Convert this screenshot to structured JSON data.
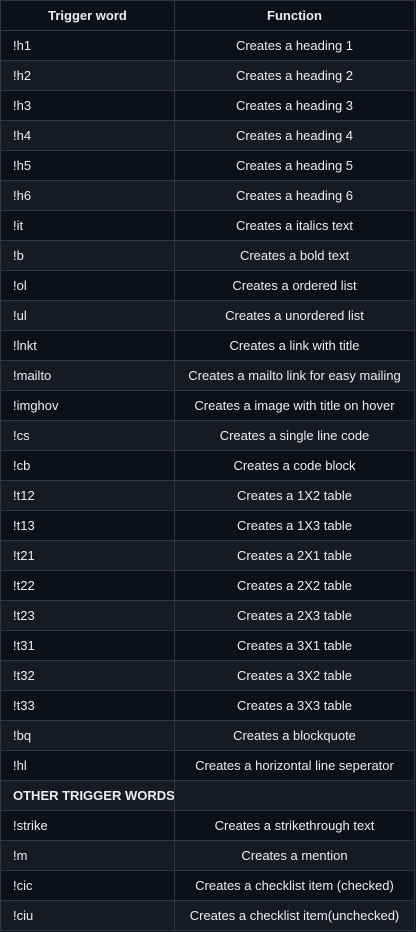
{
  "headers": {
    "trigger": "Trigger word",
    "function": "Function"
  },
  "rows": [
    {
      "trigger": "!h1",
      "function": "Creates a heading 1"
    },
    {
      "trigger": "!h2",
      "function": "Creates a heading 2"
    },
    {
      "trigger": "!h3",
      "function": "Creates a heading 3"
    },
    {
      "trigger": "!h4",
      "function": "Creates a heading 4"
    },
    {
      "trigger": "!h5",
      "function": "Creates a heading 5"
    },
    {
      "trigger": "!h6",
      "function": "Creates a heading 6"
    },
    {
      "trigger": "!it",
      "function": "Creates a italics text"
    },
    {
      "trigger": "!b",
      "function": "Creates a bold text"
    },
    {
      "trigger": "!ol",
      "function": "Creates a ordered list"
    },
    {
      "trigger": "!ul",
      "function": "Creates a unordered list"
    },
    {
      "trigger": "!lnkt",
      "function": "Creates a link with title"
    },
    {
      "trigger": "!mailto",
      "function": "Creates a mailto link for easy mailing"
    },
    {
      "trigger": "!imghov",
      "function": "Creates a image with title on hover"
    },
    {
      "trigger": "!cs",
      "function": "Creates a single line code"
    },
    {
      "trigger": "!cb",
      "function": "Creates a code block"
    },
    {
      "trigger": "!t12",
      "function": "Creates a 1X2 table"
    },
    {
      "trigger": "!t13",
      "function": "Creates a 1X3 table"
    },
    {
      "trigger": "!t21",
      "function": "Creates a 2X1 table"
    },
    {
      "trigger": "!t22",
      "function": "Creates a 2X2 table"
    },
    {
      "trigger": "!t23",
      "function": "Creates a 2X3 table"
    },
    {
      "trigger": "!t31",
      "function": "Creates a 3X1 table"
    },
    {
      "trigger": "!t32",
      "function": "Creates a 3X2 table"
    },
    {
      "trigger": "!t33",
      "function": "Creates a 3X3 table"
    },
    {
      "trigger": "!bq",
      "function": "Creates a blockquote"
    },
    {
      "trigger": "!hl",
      "function": "Creates a horizontal line seperator"
    },
    {
      "trigger": "OTHER TRIGGER WORDS",
      "function": "",
      "section": true
    },
    {
      "trigger": "!strike",
      "function": "Creates a strikethrough text"
    },
    {
      "trigger": "!m",
      "function": "Creates a mention"
    },
    {
      "trigger": "!cic",
      "function": "Creates a checklist item (checked)"
    },
    {
      "trigger": "!ciu",
      "function": "Creates a checklist item(unchecked)"
    }
  ]
}
